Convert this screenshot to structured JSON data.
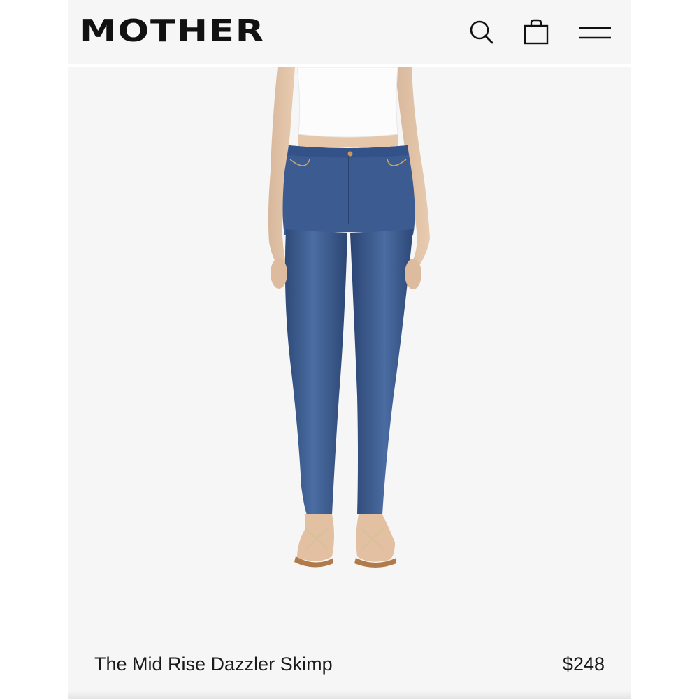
{
  "header": {
    "logo": "MOTHER",
    "search_icon": "search-icon",
    "bag_icon": "shopping-bag-icon",
    "menu_icon": "hamburger-menu-icon"
  },
  "product": {
    "name": "The Mid Rise Dazzler Skimp",
    "price": "$248",
    "image_description_icon": "product-photo",
    "colors": {
      "denim": "#3d5a8a",
      "background": "#f6f6f6",
      "top": "#ffffff"
    }
  }
}
